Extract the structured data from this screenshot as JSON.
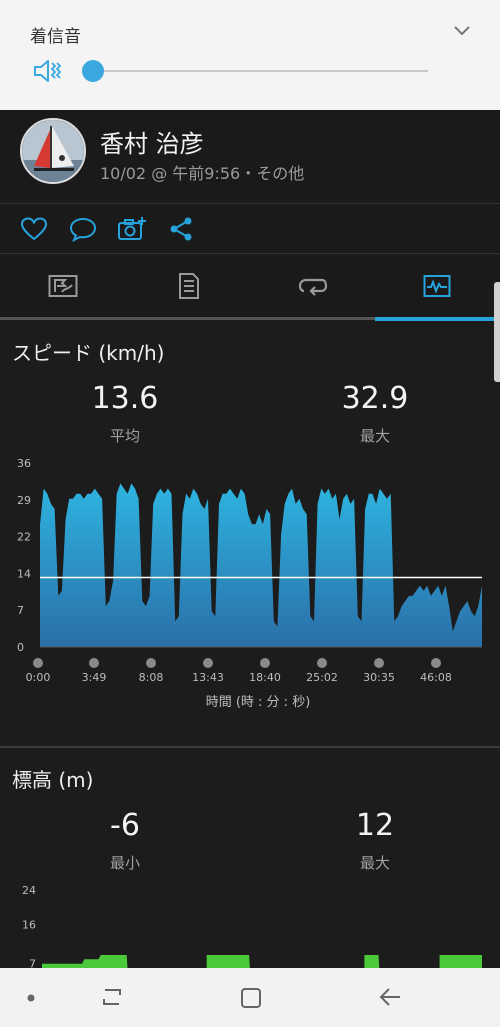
{
  "volume": {
    "title": "着信音",
    "level": 0.0,
    "speaker_icon": "speaker-vibrate-icon",
    "expand_icon": "chevron-down-icon",
    "accent": "#3aa7df"
  },
  "activity": {
    "athlete": "香村 治彦",
    "meta": "10/02 @ 午前9:56・その他"
  },
  "social_icons": [
    "heart-icon",
    "comment-icon",
    "camera-add-icon",
    "share-icon"
  ],
  "tabs": [
    {
      "icon": "map-flag-icon",
      "active": false
    },
    {
      "icon": "details-list-icon",
      "active": false
    },
    {
      "icon": "laps-loop-icon",
      "active": false
    },
    {
      "icon": "chart-icon",
      "active": true
    }
  ],
  "speed": {
    "title": "スピード (km/h)",
    "avg_value": "13.6",
    "avg_label": "平均",
    "max_value": "32.9",
    "max_label": "最大"
  },
  "elevation": {
    "title": "標高 (m)",
    "min_value": "-6",
    "min_label": "最小",
    "max_value": "12",
    "max_label": "最大"
  },
  "chart_data": [
    {
      "type": "area",
      "yticks": [
        "36",
        "29",
        "22",
        "14",
        "7",
        "0"
      ],
      "ylim": [
        0,
        36
      ],
      "xticks": [
        "0:00",
        "3:49",
        "8:08",
        "13:43",
        "18:40",
        "25:02",
        "30:35",
        "46:08"
      ],
      "xlabel": "時間 (時 : 分 : 秒)",
      "average_line": 13.6,
      "color": "#29a8d8",
      "series": [
        {
          "values": [
            24,
            31,
            30,
            28,
            27,
            10,
            11,
            25,
            29,
            29,
            30,
            30,
            29,
            30,
            30,
            31,
            30,
            29,
            8,
            9,
            13,
            30,
            32,
            31,
            30,
            32,
            31,
            29,
            9,
            8,
            10,
            28,
            30,
            31,
            30,
            31,
            30,
            5,
            6,
            26,
            30,
            29,
            31,
            30,
            28,
            27,
            29,
            7,
            6,
            28,
            30,
            30,
            31,
            30,
            29,
            31,
            30,
            26,
            24,
            24,
            26,
            24,
            27,
            26,
            5,
            4,
            22,
            28,
            30,
            31,
            28,
            29,
            27,
            26,
            6,
            5,
            28,
            31,
            30,
            31,
            29,
            30,
            25,
            29,
            30,
            28,
            29,
            6,
            5,
            27,
            30,
            30,
            28,
            31,
            30,
            29,
            30,
            5,
            6,
            8,
            9,
            10,
            10,
            11,
            12,
            11,
            12,
            10,
            11,
            12,
            10,
            12,
            8,
            3,
            5,
            7,
            8,
            9,
            7,
            6,
            8,
            12
          ]
        }
      ]
    },
    {
      "type": "area",
      "yticks": [
        "24",
        "16",
        "7"
      ],
      "ylim": [
        0,
        24
      ],
      "color": "#4cc93a",
      "series": [
        {
          "values": [
            7,
            7,
            7,
            7,
            7,
            7,
            7,
            7,
            7,
            7,
            7,
            7,
            7,
            7,
            7,
            7,
            7,
            7,
            8,
            8,
            8,
            8,
            8,
            8,
            8,
            9,
            9,
            9,
            9,
            9,
            9,
            9,
            9,
            9,
            9,
            9,
            9,
            0,
            0,
            0,
            0,
            0,
            0,
            0,
            0,
            0,
            0,
            0,
            0,
            0,
            0,
            0,
            0,
            0,
            0,
            0,
            0,
            0,
            0,
            0,
            0,
            0,
            0,
            0,
            0,
            0,
            0,
            0,
            0,
            0,
            9,
            9,
            9,
            9,
            9,
            9,
            9,
            9,
            9,
            9,
            9,
            9,
            9,
            9,
            9,
            9,
            9,
            9,
            9,
            0,
            0,
            0,
            0,
            0,
            0,
            0,
            0,
            0,
            0,
            0,
            0,
            0,
            0,
            0,
            0,
            0,
            0,
            0,
            0,
            0,
            0,
            0,
            0,
            0,
            0,
            0,
            0,
            0,
            0,
            0,
            0,
            0,
            0,
            0,
            0,
            0,
            0,
            0,
            0,
            0,
            0,
            0,
            0,
            0,
            0,
            0,
            0,
            9,
            9,
            9,
            9,
            9,
            9,
            9,
            0,
            0,
            0,
            0,
            0,
            0,
            0,
            0,
            0,
            0,
            0,
            0,
            0,
            0,
            0,
            0,
            0,
            0,
            0,
            0,
            0,
            0,
            0,
            0,
            0,
            9,
            9,
            9,
            9,
            9,
            9,
            9,
            9,
            9,
            9,
            9,
            9,
            9,
            9,
            9,
            9,
            9,
            9,
            9
          ]
        }
      ]
    }
  ],
  "navbar": {
    "icons": [
      "dot-icon",
      "recent-apps-icon",
      "home-icon",
      "back-icon"
    ]
  }
}
